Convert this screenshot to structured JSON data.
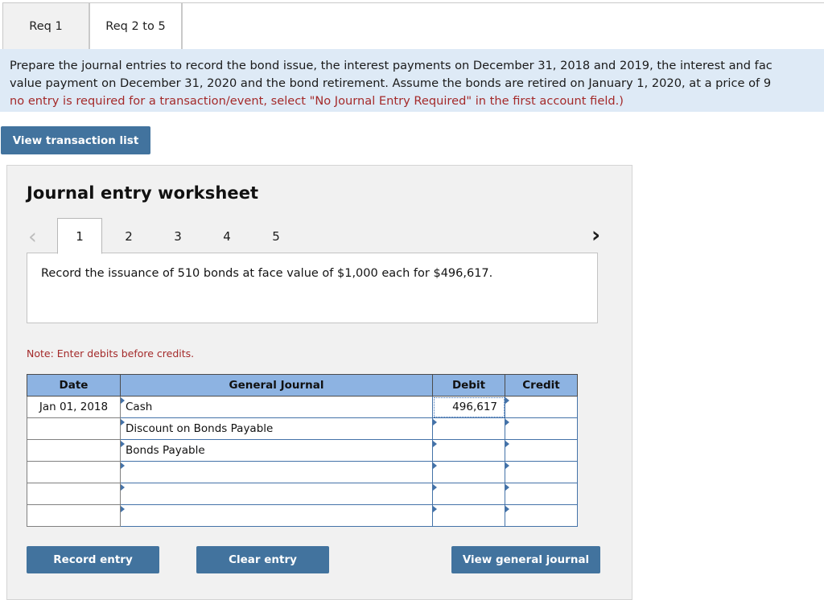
{
  "tabs": [
    {
      "label": "Req 1",
      "active": false
    },
    {
      "label": "Req 2 to 5",
      "active": true
    }
  ],
  "instructions": {
    "line1": "Prepare the journal entries to record the bond issue, the interest payments on December 31, 2018 and 2019,  the interest and fac",
    "line2": "value payment on December 31, 2020 and the bond retirement. Assume the bonds are retired on January 1, 2020, at a price of  9",
    "line3": "no entry is required for a transaction/event, select \"No Journal Entry Required\" in the first account field.)"
  },
  "toolbar": {
    "view_transaction_list_label": "View transaction list"
  },
  "worksheet": {
    "title": "Journal entry worksheet",
    "prev_icon": "chevron-left-icon",
    "next_icon": "chevron-right-icon",
    "prev_glyph": "‹",
    "next_glyph": "›",
    "pages": [
      {
        "label": "1",
        "active": true
      },
      {
        "label": "2",
        "active": false
      },
      {
        "label": "3",
        "active": false
      },
      {
        "label": "4",
        "active": false
      },
      {
        "label": "5",
        "active": false
      }
    ],
    "description": "Record the issuance of 510 bonds at face value of $1,000 each for $496,617.",
    "note": "Note: Enter debits before credits."
  },
  "journal": {
    "columns": [
      "Date",
      "General Journal",
      "Debit",
      "Credit"
    ],
    "rows": [
      {
        "date": "Jan 01, 2018",
        "account": "Cash",
        "debit": "496,617",
        "credit": "",
        "debit_selected": true
      },
      {
        "date": "",
        "account": "Discount on Bonds Payable",
        "debit": "",
        "credit": "",
        "debit_selected": false
      },
      {
        "date": "",
        "account": "Bonds Payable",
        "debit": "",
        "credit": "",
        "debit_selected": false
      },
      {
        "date": "",
        "account": "",
        "debit": "",
        "credit": "",
        "debit_selected": false
      },
      {
        "date": "",
        "account": "",
        "debit": "",
        "credit": "",
        "debit_selected": false
      },
      {
        "date": "",
        "account": "",
        "debit": "",
        "credit": "",
        "debit_selected": false
      }
    ]
  },
  "footer": {
    "record_entry_label": "Record entry",
    "clear_entry_label": "Clear entry",
    "view_general_journal_label": "View general journal"
  },
  "colors": {
    "accent_button": "#42739e",
    "banner_background": "#deeaf6",
    "table_header": "#8db3e2",
    "warning_text": "#a42a2a",
    "field_border": "#4472a8"
  }
}
